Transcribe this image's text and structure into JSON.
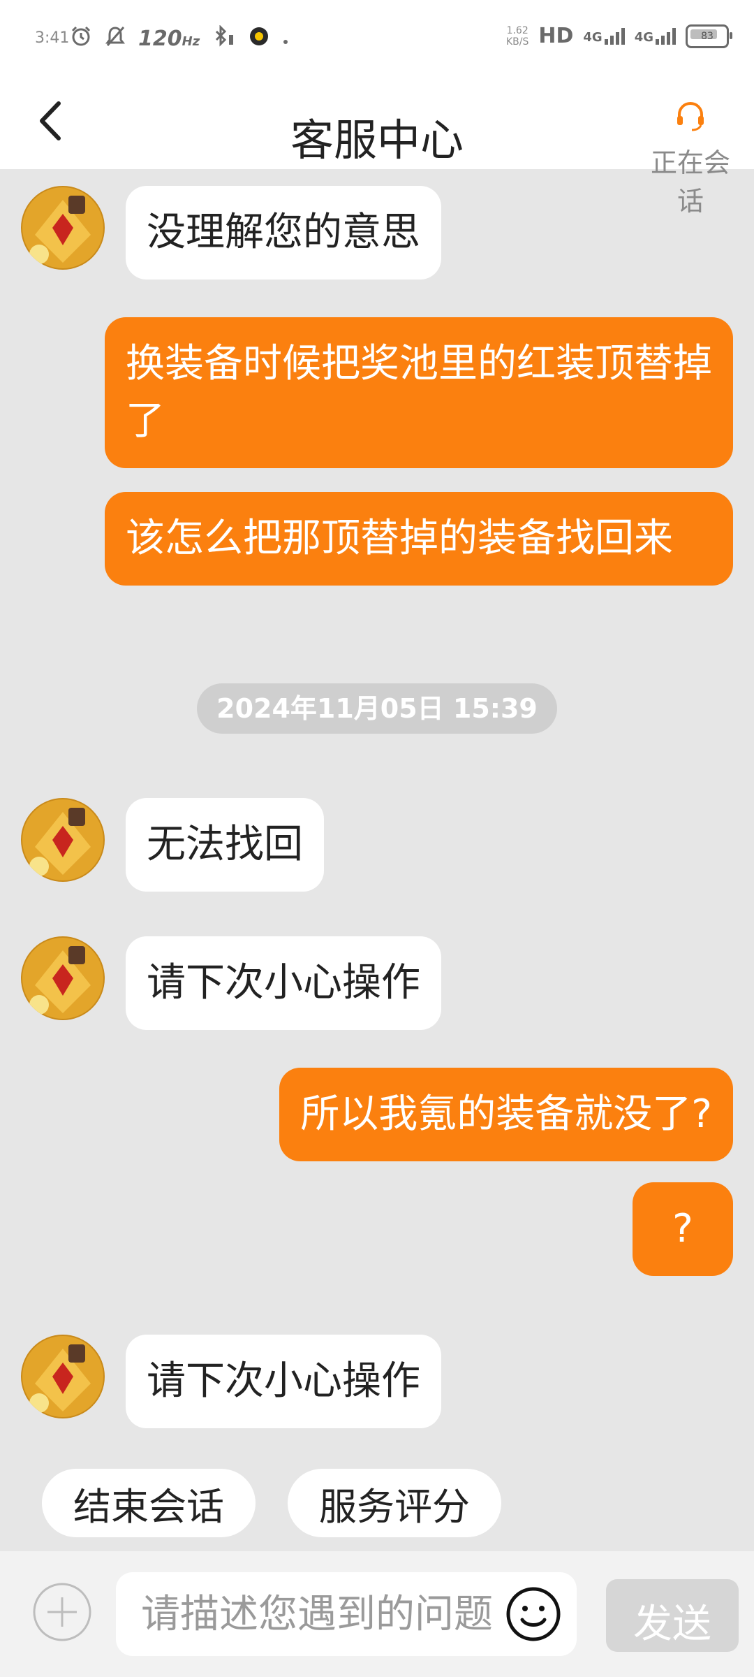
{
  "status_bar": {
    "time": "3:41",
    "refresh_rate": "120",
    "refresh_unit": "Hz",
    "net_speed_value": "1.62",
    "net_speed_unit": "KB/S",
    "hd_label": "HD",
    "network_1": "4G",
    "network_2": "4G",
    "battery": "83"
  },
  "header": {
    "title": "客服中心",
    "session_status": "正在会话",
    "accent_color": "#fb800f"
  },
  "messages": [
    {
      "side": "agent",
      "text": "没理解您的意思"
    },
    {
      "side": "user",
      "text": "换装备时候把奖池里的红装顶替掉了"
    },
    {
      "side": "user",
      "text": "该怎么把那顶替掉的装备找回来"
    },
    {
      "side": "agent",
      "text": "无法找回"
    },
    {
      "side": "agent",
      "text": "请下次小心操作"
    },
    {
      "side": "user",
      "text": "所以我氪的装备就没了?"
    },
    {
      "side": "user",
      "text": "?"
    },
    {
      "side": "agent",
      "text": "请下次小心操作"
    }
  ],
  "timestamp": "2024年11月05日 15:39",
  "quick_actions": {
    "end_session": "结束会话",
    "rate_service": "服务评分"
  },
  "input_bar": {
    "placeholder": "请描述您遇到的问题",
    "send_label": "发送"
  }
}
